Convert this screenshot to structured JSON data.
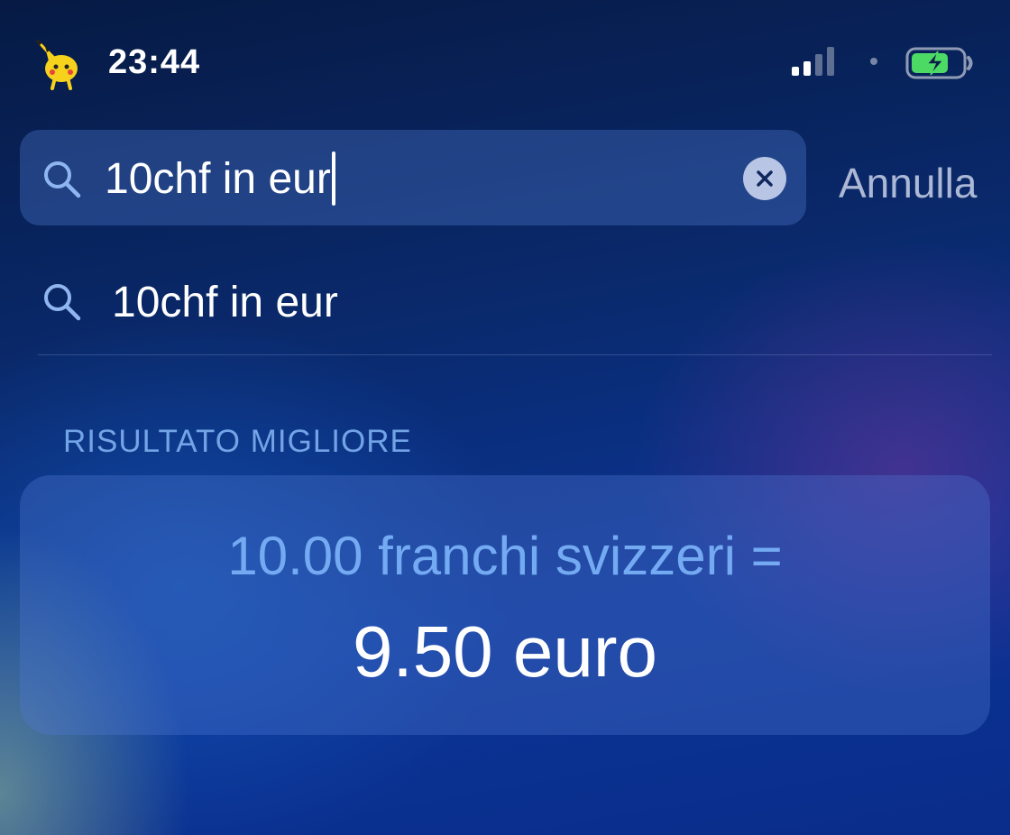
{
  "status_bar": {
    "time": "23:44",
    "signal_bars": 4,
    "signal_active_bars": 2,
    "battery_charging": true,
    "battery_level": 0.75,
    "mascot_icon": "pikachu-sticker-icon",
    "carrier_icon": "carrier-symbol-icon"
  },
  "search": {
    "query": "10chf in eur",
    "search_icon": "search-icon",
    "clear_icon": "clear-icon",
    "cancel_label": "Annulla"
  },
  "suggestion": {
    "text": "10chf in eur",
    "icon": "search-icon"
  },
  "results": {
    "section_title": "RISULTATO MIGLIORE",
    "conversion": {
      "from": "10.00 franchi svizzeri =",
      "to": "9.50 euro"
    }
  },
  "colors": {
    "accent": "#7aaef0",
    "text": "#ffffff",
    "cancel": "#bec8e1",
    "battery": "#4cd964"
  }
}
